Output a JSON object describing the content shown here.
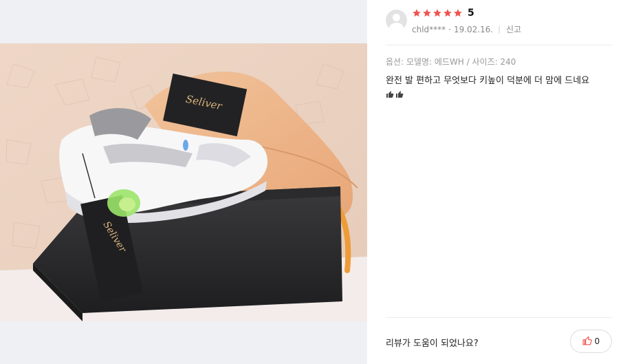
{
  "review": {
    "rating": {
      "stars_filled": 5,
      "stars_total": 5,
      "score_text": "5",
      "star_color": "#ef5350"
    },
    "author": "chld****",
    "dot": "·",
    "date": "19.02.16.",
    "separator": "|",
    "report_label": "신고",
    "option_text": "옵션: 모델명: 에드WH / 사이즈: 240",
    "content_text": "완전 발 편하고 무엇보다 키높이 덕분에 더 맘에 드네요",
    "content_emoji": [
      "thumbs-up-icon",
      "thumbs-up-icon"
    ],
    "helpful_question": "리뷰가 도움이 되었나요?",
    "like_count": "0",
    "like_color": "#ef5350"
  },
  "photo": {
    "hang_tag_logo": "Seliver",
    "shoe_tongue_logo": "SELIVER"
  }
}
